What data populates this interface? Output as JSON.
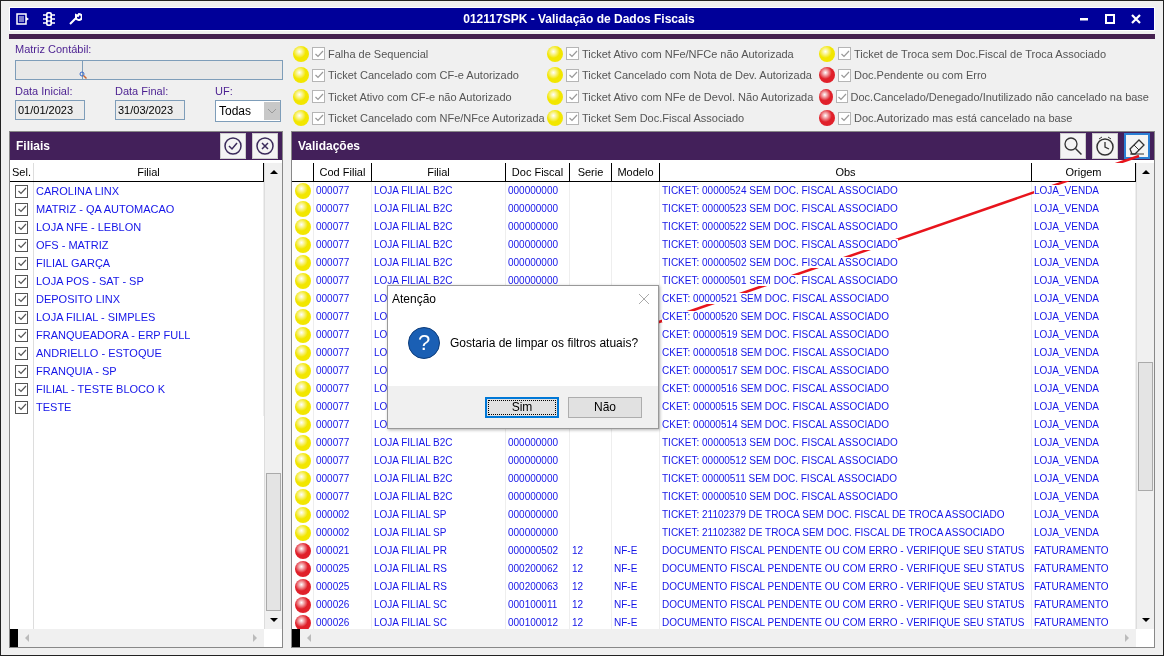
{
  "window": {
    "title": "012117SPK - Validação de Dados Fiscais"
  },
  "filters": {
    "matriz_label": "Matriz Contábil:",
    "date_start_label": "Data Inicial:",
    "date_start_value": "01/01/2023",
    "date_end_label": "Data Final:",
    "date_end_value": "31/03/2023",
    "uf_label": "UF:",
    "uf_value": "Todas"
  },
  "legend": [
    {
      "color": "#f2e600",
      "checked": true,
      "label": "Falha de Sequencial"
    },
    {
      "color": "#f2e600",
      "checked": true,
      "label": "Ticket Cancelado com CF-e Autorizado"
    },
    {
      "color": "#f2e600",
      "checked": true,
      "label": "Ticket Ativo com CF-e não Autorizado"
    },
    {
      "color": "#f2e600",
      "checked": true,
      "label": "Ticket Cancelado com NFe/NFce Autorizada"
    },
    {
      "color": "#f2e600",
      "checked": true,
      "label": "Ticket Ativo com NFe/NFCe não Autorizada"
    },
    {
      "color": "#f2e600",
      "checked": true,
      "label": "Ticket Cancelado com Nota de Dev. Autorizada"
    },
    {
      "color": "#f2e600",
      "checked": true,
      "label": "Ticket Ativo com NFe de Devol. Não Autorizada"
    },
    {
      "color": "#f2e600",
      "checked": true,
      "label": "Ticket Sem Doc.Fiscal Associado"
    },
    {
      "color": "#f2e600",
      "checked": true,
      "label": "Ticket de Troca sem Doc.Fiscal de Troca Associado"
    },
    {
      "color": "#e0202a",
      "checked": true,
      "label": "Doc.Pendente ou com Erro"
    },
    {
      "color": "#e0202a",
      "checked": true,
      "label": "Doc.Cancelado/Denegado/Inutilizado não cancelado na base"
    },
    {
      "color": "#e0202a",
      "checked": true,
      "label": "Doc.Autorizado mas está cancelado na base"
    }
  ],
  "filiais": {
    "title": "Filiais",
    "columns": [
      "Sel.",
      "Filial"
    ],
    "rows": [
      {
        "checked": true,
        "name": "CAROLINA LINX"
      },
      {
        "checked": true,
        "name": "MATRIZ - QA AUTOMACAO"
      },
      {
        "checked": true,
        "name": "LOJA NFE - LEBLON"
      },
      {
        "checked": true,
        "name": "OFS - MATRIZ"
      },
      {
        "checked": true,
        "name": "FILIAL GARÇA"
      },
      {
        "checked": true,
        "name": "LOJA POS - SAT - SP"
      },
      {
        "checked": true,
        "name": "DEPOSITO LINX"
      },
      {
        "checked": true,
        "name": "LOJA FILIAL - SIMPLES"
      },
      {
        "checked": true,
        "name": "FRANQUEADORA - ERP FULL"
      },
      {
        "checked": true,
        "name": "ANDRIELLO - ESTOQUE"
      },
      {
        "checked": true,
        "name": "FRANQUIA - SP"
      },
      {
        "checked": true,
        "name": "FILIAL - TESTE BLOCO K"
      },
      {
        "checked": true,
        "name": "TESTE"
      }
    ]
  },
  "validacoes": {
    "title": "Validações",
    "columns": [
      "Cod Filial",
      "Filial",
      "Doc Fiscal",
      "Serie",
      "Modelo",
      "Obs",
      "Origem"
    ],
    "rows": [
      {
        "color": "#f2e600",
        "cod": "000077",
        "filial": "LOJA FILIAL B2C",
        "doc": "000000000",
        "serie": "",
        "modelo": "",
        "obs": "TICKET: 00000524 SEM DOC. FISCAL ASSOCIADO",
        "origem": "LOJA_VENDA"
      },
      {
        "color": "#f2e600",
        "cod": "000077",
        "filial": "LOJA FILIAL B2C",
        "doc": "000000000",
        "serie": "",
        "modelo": "",
        "obs": "TICKET: 00000523 SEM DOC. FISCAL ASSOCIADO",
        "origem": "LOJA_VENDA"
      },
      {
        "color": "#f2e600",
        "cod": "000077",
        "filial": "LOJA FILIAL B2C",
        "doc": "000000000",
        "serie": "",
        "modelo": "",
        "obs": "TICKET: 00000522 SEM DOC. FISCAL ASSOCIADO",
        "origem": "LOJA_VENDA"
      },
      {
        "color": "#f2e600",
        "cod": "000077",
        "filial": "LOJA FILIAL B2C",
        "doc": "000000000",
        "serie": "",
        "modelo": "",
        "obs": "TICKET: 00000503 SEM DOC. FISCAL ASSOCIADO",
        "origem": "LOJA_VENDA"
      },
      {
        "color": "#f2e600",
        "cod": "000077",
        "filial": "LOJA FILIAL B2C",
        "doc": "000000000",
        "serie": "",
        "modelo": "",
        "obs": "TICKET: 00000502 SEM DOC. FISCAL ASSOCIADO",
        "origem": "LOJA_VENDA"
      },
      {
        "color": "#f2e600",
        "cod": "000077",
        "filial": "LOJA FILIAL B2C",
        "doc": "000000000",
        "serie": "",
        "modelo": "",
        "obs": "TICKET: 00000501 SEM DOC. FISCAL ASSOCIADO",
        "origem": "LOJA_VENDA"
      },
      {
        "color": "#f2e600",
        "cod": "000077",
        "filial": "LO",
        "doc": "",
        "serie": "",
        "modelo": "",
        "obs": "CKET: 00000521 SEM DOC. FISCAL ASSOCIADO",
        "origem": "LOJA_VENDA"
      },
      {
        "color": "#f2e600",
        "cod": "000077",
        "filial": "LO",
        "doc": "",
        "serie": "",
        "modelo": "",
        "obs": "CKET: 00000520 SEM DOC. FISCAL ASSOCIADO",
        "origem": "LOJA_VENDA"
      },
      {
        "color": "#f2e600",
        "cod": "000077",
        "filial": "LO",
        "doc": "",
        "serie": "",
        "modelo": "",
        "obs": "CKET: 00000519 SEM DOC. FISCAL ASSOCIADO",
        "origem": "LOJA_VENDA"
      },
      {
        "color": "#f2e600",
        "cod": "000077",
        "filial": "LO",
        "doc": "",
        "serie": "",
        "modelo": "",
        "obs": "CKET: 00000518 SEM DOC. FISCAL ASSOCIADO",
        "origem": "LOJA_VENDA"
      },
      {
        "color": "#f2e600",
        "cod": "000077",
        "filial": "LO",
        "doc": "",
        "serie": "",
        "modelo": "",
        "obs": "CKET: 00000517 SEM DOC. FISCAL ASSOCIADO",
        "origem": "LOJA_VENDA"
      },
      {
        "color": "#f2e600",
        "cod": "000077",
        "filial": "LO",
        "doc": "",
        "serie": "",
        "modelo": "",
        "obs": "CKET: 00000516 SEM DOC. FISCAL ASSOCIADO",
        "origem": "LOJA_VENDA"
      },
      {
        "color": "#f2e600",
        "cod": "000077",
        "filial": "LO",
        "doc": "",
        "serie": "",
        "modelo": "",
        "obs": "CKET: 00000515 SEM DOC. FISCAL ASSOCIADO",
        "origem": "LOJA_VENDA"
      },
      {
        "color": "#f2e600",
        "cod": "000077",
        "filial": "LO",
        "doc": "",
        "serie": "",
        "modelo": "",
        "obs": "CKET: 00000514 SEM DOC. FISCAL ASSOCIADO",
        "origem": "LOJA_VENDA"
      },
      {
        "color": "#f2e600",
        "cod": "000077",
        "filial": "LOJA FILIAL B2C",
        "doc": "000000000",
        "serie": "",
        "modelo": "",
        "obs": "TICKET: 00000513 SEM DOC. FISCAL ASSOCIADO",
        "origem": "LOJA_VENDA"
      },
      {
        "color": "#f2e600",
        "cod": "000077",
        "filial": "LOJA FILIAL B2C",
        "doc": "000000000",
        "serie": "",
        "modelo": "",
        "obs": "TICKET: 00000512 SEM DOC. FISCAL ASSOCIADO",
        "origem": "LOJA_VENDA"
      },
      {
        "color": "#f2e600",
        "cod": "000077",
        "filial": "LOJA FILIAL B2C",
        "doc": "000000000",
        "serie": "",
        "modelo": "",
        "obs": "TICKET: 00000511 SEM DOC. FISCAL ASSOCIADO",
        "origem": "LOJA_VENDA"
      },
      {
        "color": "#f2e600",
        "cod": "000077",
        "filial": "LOJA FILIAL B2C",
        "doc": "000000000",
        "serie": "",
        "modelo": "",
        "obs": "TICKET: 00000510 SEM DOC. FISCAL ASSOCIADO",
        "origem": "LOJA_VENDA"
      },
      {
        "color": "#f2e600",
        "cod": "000002",
        "filial": "LOJA FILIAL SP",
        "doc": "000000000",
        "serie": "",
        "modelo": "",
        "obs": "TICKET: 21102379 DE TROCA SEM DOC. FISCAL DE TROCA ASSOCIADO",
        "origem": "LOJA_VENDA"
      },
      {
        "color": "#f2e600",
        "cod": "000002",
        "filial": "LOJA FILIAL SP",
        "doc": "000000000",
        "serie": "",
        "modelo": "",
        "obs": "TICKET: 21102382 DE TROCA SEM DOC. FISCAL DE TROCA ASSOCIADO",
        "origem": "LOJA_VENDA"
      },
      {
        "color": "#e0202a",
        "cod": "000021",
        "filial": "LOJA FILIAL PR",
        "doc": "000000502",
        "serie": "12",
        "modelo": "NF-E",
        "obs": "DOCUMENTO FISCAL PENDENTE OU COM ERRO - VERIFIQUE SEU STATUS",
        "origem": "FATURAMENTO"
      },
      {
        "color": "#e0202a",
        "cod": "000025",
        "filial": "LOJA FILIAL RS",
        "doc": "000200062",
        "serie": "12",
        "modelo": "NF-E",
        "obs": "DOCUMENTO FISCAL PENDENTE OU COM ERRO - VERIFIQUE SEU STATUS",
        "origem": "FATURAMENTO"
      },
      {
        "color": "#e0202a",
        "cod": "000025",
        "filial": "LOJA FILIAL RS",
        "doc": "000200063",
        "serie": "12",
        "modelo": "NF-E",
        "obs": "DOCUMENTO FISCAL PENDENTE OU COM ERRO - VERIFIQUE SEU STATUS",
        "origem": "FATURAMENTO"
      },
      {
        "color": "#e0202a",
        "cod": "000026",
        "filial": "LOJA FILIAL SC",
        "doc": "000100011",
        "serie": "12",
        "modelo": "NF-E",
        "obs": "DOCUMENTO FISCAL PENDENTE OU COM ERRO - VERIFIQUE SEU STATUS",
        "origem": "FATURAMENTO"
      },
      {
        "color": "#e0202a",
        "cod": "000026",
        "filial": "LOJA FILIAL SC",
        "doc": "000100012",
        "serie": "12",
        "modelo": "NF-E",
        "obs": "DOCUMENTO FISCAL PENDENTE OU COM ERRO - VERIFIQUE SEU STATUS",
        "origem": "FATURAMENTO"
      }
    ]
  },
  "dialog": {
    "title": "Atenção",
    "icon_glyph": "?",
    "message": "Gostaria de limpar os filtros atuais?",
    "buttons": [
      {
        "label": "Sim",
        "selected": true
      },
      {
        "label": "Não",
        "selected": false
      }
    ]
  }
}
